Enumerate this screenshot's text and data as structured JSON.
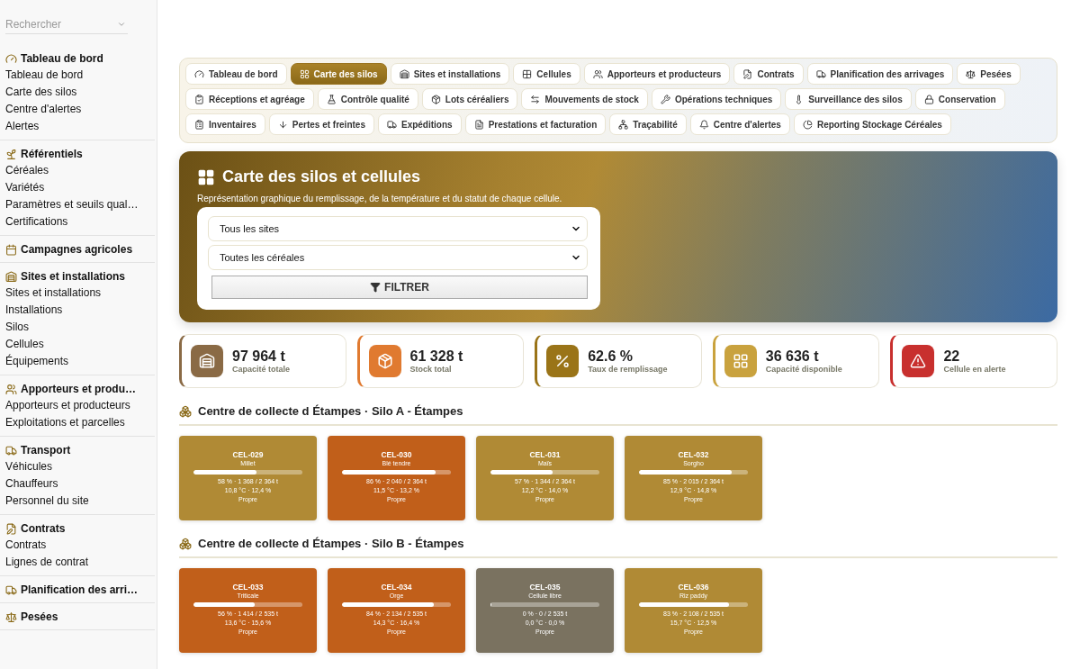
{
  "sidebar": {
    "search": {
      "placeholder": "Rechercher"
    },
    "sections": [
      {
        "title": "Tableau de bord",
        "items": [
          "Tableau de bord",
          "Carte des silos",
          "Centre d'alertes",
          "Alertes"
        ]
      },
      {
        "title": "Référentiels",
        "items": [
          "Céréales",
          "Variétés",
          "Paramètres et seuils qual…",
          "Certifications"
        ]
      },
      {
        "title": "Campagnes agricoles"
      },
      {
        "title": "Sites et installations",
        "items": [
          "Sites et installations",
          "Installations",
          "Silos",
          "Cellules",
          "Équipements"
        ]
      },
      {
        "title": "Apporteurs et produ…",
        "items": [
          "Apporteurs et producteurs",
          "Exploitations et parcelles"
        ]
      },
      {
        "title": "Transport",
        "items": [
          "Véhicules",
          "Chauffeurs",
          "Personnel du site"
        ]
      },
      {
        "title": "Contrats",
        "items": [
          "Contrats",
          "Lignes de contrat"
        ]
      },
      {
        "title": "Planification des arri…"
      },
      {
        "title": "Pesées"
      }
    ]
  },
  "tabs": [
    {
      "label": "Tableau de bord",
      "selected": false
    },
    {
      "label": "Carte des silos",
      "selected": true
    },
    {
      "label": "Sites et installations",
      "selected": false
    },
    {
      "label": "Cellules",
      "selected": false
    },
    {
      "label": "Apporteurs et producteurs",
      "selected": false
    },
    {
      "label": "Contrats",
      "selected": false
    },
    {
      "label": "Planification des arrivages",
      "selected": false
    },
    {
      "label": "Pesées",
      "selected": false
    },
    {
      "label": "Réceptions et agréage",
      "selected": false
    },
    {
      "label": "Contrôle qualité",
      "selected": false
    },
    {
      "label": "Lots céréaliers",
      "selected": false
    },
    {
      "label": "Mouvements de stock",
      "selected": false
    },
    {
      "label": "Opérations techniques",
      "selected": false
    },
    {
      "label": "Surveillance des silos",
      "selected": false
    },
    {
      "label": "Conservation",
      "selected": false
    },
    {
      "label": "Inventaires",
      "selected": false
    },
    {
      "label": "Pertes et freintes",
      "selected": false
    },
    {
      "label": "Expéditions",
      "selected": false
    },
    {
      "label": "Prestations et facturation",
      "selected": false
    },
    {
      "label": "Traçabilité",
      "selected": false
    },
    {
      "label": "Centre d'alertes",
      "selected": false
    },
    {
      "label": "Reporting Stockage Céréales",
      "selected": false
    }
  ],
  "hero": {
    "title": "Carte des silos et cellules",
    "subtitle": "Représentation graphique du remplissage, de la température et du statut de chaque cellule.",
    "filters": [
      "Tous les sites",
      "Toutes les céréales"
    ],
    "button": "FILTRER"
  },
  "stats": [
    {
      "value": "97 964 t",
      "label": "Capacité totale",
      "color": "#8a6a45"
    },
    {
      "value": "61 328 t",
      "label": "Stock total",
      "color": "#e07a30"
    },
    {
      "value": "62.6 %",
      "label": "Taux de remplissage",
      "color": "#9a7418"
    },
    {
      "value": "36 636 t",
      "label": "Capacité disponible",
      "color": "#c9a23e"
    },
    {
      "value": "22",
      "label": "Cellule en alerte",
      "color": "#c8302e"
    }
  ],
  "groups": [
    {
      "title": "Centre de collecte d Étampes · Silo A - Étampes",
      "cells": [
        {
          "code": "CEL-029",
          "cereal": "Millet",
          "level": 0.58,
          "fill": "58 % · 1 368 / 2 364 t",
          "climate": "10,8 °C · 12,4 %",
          "status": "Propre",
          "color": "#b08a35"
        },
        {
          "code": "CEL-030",
          "cereal": "Blé tendre",
          "level": 0.86,
          "fill": "86 % · 2 040 / 2 364 t",
          "climate": "11,5 °C · 13,2 %",
          "status": "Propre",
          "color": "#c15f1a"
        },
        {
          "code": "CEL-031",
          "cereal": "Maïs",
          "level": 0.57,
          "fill": "57 % · 1 344 / 2 364 t",
          "climate": "12,2 °C · 14,0 %",
          "status": "Propre",
          "color": "#b08a35"
        },
        {
          "code": "CEL-032",
          "cereal": "Sorgho",
          "level": 0.85,
          "fill": "85 % · 2 015 / 2 364 t",
          "climate": "12,9 °C · 14,8 %",
          "status": "Propre",
          "color": "#b08a35"
        }
      ]
    },
    {
      "title": "Centre de collecte d Étampes · Silo B - Étampes",
      "cells": [
        {
          "code": "CEL-033",
          "cereal": "Triticale",
          "level": 0.56,
          "fill": "56 % · 1 414 / 2 535 t",
          "climate": "13,6 °C · 15,6 %",
          "status": "Propre",
          "color": "#c15f1a"
        },
        {
          "code": "CEL-034",
          "cereal": "Orge",
          "level": 0.84,
          "fill": "84 % · 2 134 / 2 535 t",
          "climate": "14,3 °C · 16,4 %",
          "status": "Propre",
          "color": "#c15f1a"
        },
        {
          "code": "CEL-035",
          "cereal": "Cellule libre",
          "level": 0,
          "fill": "0 % · 0 / 2 535 t",
          "climate": "0,0 °C · 0,0 %",
          "status": "Propre",
          "color": "#7a7260"
        },
        {
          "code": "CEL-036",
          "cereal": "Riz paddy",
          "level": 0.83,
          "fill": "83 % · 2 108 / 2 535 t",
          "climate": "15,7 °C · 12,5 %",
          "status": "Propre",
          "color": "#b08a35"
        }
      ]
    }
  ]
}
